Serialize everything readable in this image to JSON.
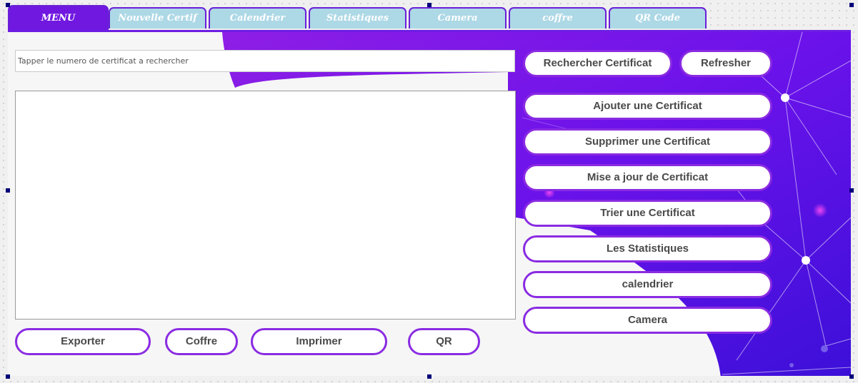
{
  "tabs": [
    {
      "label": "MENU",
      "active": true
    },
    {
      "label": "Nouvelle Certif",
      "active": false
    },
    {
      "label": "Calendrier",
      "active": false
    },
    {
      "label": "Statistiques",
      "active": false
    },
    {
      "label": "Camera",
      "active": false
    },
    {
      "label": "coffre",
      "active": false
    },
    {
      "label": "QR Code",
      "active": false
    }
  ],
  "search": {
    "placeholder": "Tapper le numero de certificat a rechercher",
    "value": ""
  },
  "top_buttons": {
    "search_label": "Rechercher Certificat",
    "refresh_label": "Refresher"
  },
  "side_buttons": {
    "add": "Ajouter une Certificat",
    "delete": "Supprimer une Certificat",
    "update": "Mise a jour de Certificat",
    "sort": "Trier une Certificat",
    "stats": "Les Statistiques",
    "calendar": "calendrier",
    "camera": "Camera"
  },
  "bottom_buttons": {
    "export": "Exporter",
    "vault": "Coffre",
    "print": "Imprimer",
    "qr": "QR"
  },
  "colors": {
    "accent": "#7018e0",
    "tab_inactive": "#add8e6",
    "button_border": "#8a2be2",
    "selection_handle": "#00007a"
  }
}
